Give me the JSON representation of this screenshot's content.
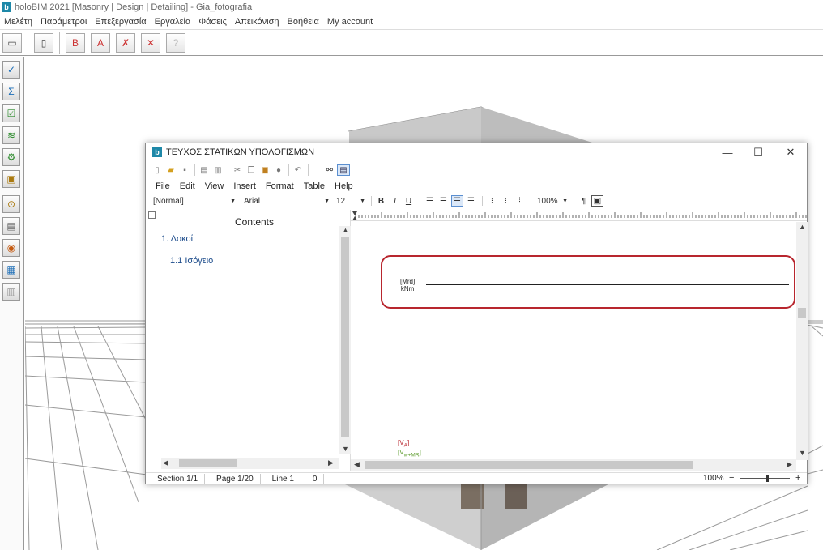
{
  "app": {
    "logo": "b",
    "title": "holoBIM 2021 [Masonry | Design | Detailing] - Gia_fotografia"
  },
  "menubar": {
    "items": [
      "Μελέτη",
      "Παράμετροι",
      "Επεξεργασία",
      "Εργαλεία",
      "Φάσεις",
      "Απεικόνιση",
      "Βοήθεια",
      "My account"
    ]
  },
  "toolbar": {
    "buttons": [
      "new-file-icon",
      "open-file-icon",
      "report-b-icon",
      "report-a-icon",
      "delete-file-icon",
      "close-icon",
      "help-icon"
    ]
  },
  "sidebar": {
    "tools": [
      "check-icon",
      "sum-icon",
      "checklist-icon",
      "graph-icon",
      "gears-icon",
      "save-icon",
      "zoom-icon",
      "frame-icon",
      "globe-icon",
      "grid-icon",
      "print-icon"
    ]
  },
  "dialog": {
    "logo": "b",
    "title": "ΤΕΥΧΟΣ ΣΤΑΤΙΚΩΝ ΥΠΟΛΟΓΙΣΜΩΝ",
    "controls": {
      "minimize": "—",
      "maximize": "☐",
      "close": "✕"
    },
    "menu": [
      "File",
      "Edit",
      "View",
      "Insert",
      "Format",
      "Table",
      "Help"
    ],
    "format": {
      "style": "[Normal]",
      "font": "Arial",
      "size": "12",
      "zoom": "100%",
      "bold": "B",
      "italic": "I",
      "underline": "U"
    },
    "contents": {
      "header": "Contents",
      "items": [
        {
          "label": "1. Δοκοί"
        },
        {
          "label": "1.1 Ισόγειο"
        }
      ]
    },
    "document": {
      "mrd_label": "[Mrd]",
      "mrd_unit": "kNm",
      "va_label": "[V",
      "va_sub": "A",
      "va_close": "]",
      "vw_label": "[V",
      "vw_sub": "w+MR",
      "vw_close": "]"
    },
    "status": {
      "section": "Section 1/1",
      "page": "Page 1/20",
      "line": "Line 1",
      "col": "0",
      "zoom": "100%",
      "minus": "−",
      "plus": "+",
      "zoom_level": 0.55
    }
  },
  "colors": {
    "accent": "#1e88a8",
    "highlight_box": "#b8262e",
    "toc_text": "#1a4a8a",
    "vw_label": "#5a9a2a"
  }
}
